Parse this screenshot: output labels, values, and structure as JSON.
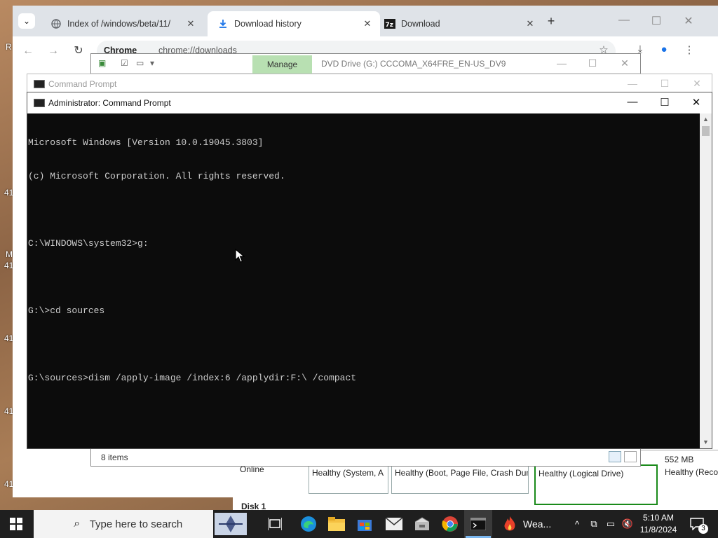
{
  "desktop": {
    "fragments": [
      "R",
      "41",
      "41",
      "41",
      "41",
      "41",
      "41",
      "M"
    ]
  },
  "chrome": {
    "tabs": [
      {
        "label": "Index of /windows/beta/11/",
        "icon": "globe-icon",
        "close": "✕"
      },
      {
        "label": "Download history",
        "icon": "download-icon",
        "close": "✕",
        "active": true
      },
      {
        "label": "Download",
        "icon": "7zip-icon",
        "close": "✕"
      }
    ],
    "new_tab": "+",
    "omnibox_chip": "Chrome",
    "url": "chrome://downloads",
    "controls": {
      "minimize": "—",
      "maximize": "☐",
      "close": "✕"
    }
  },
  "explorer": {
    "manage_label": "Manage",
    "caption": "DVD Drive (G:) CCCOMA_X64FRE_EN-US_DV9",
    "status_items": "8 items"
  },
  "disk_management": {
    "online": "Online",
    "cells": [
      "Healthy (System, A",
      "Healthy (Boot, Page File, Crash Dum",
      "Healthy (Logical Drive)",
      "Healthy (Reco"
    ],
    "size": "552 MB",
    "disk1": "Disk 1"
  },
  "cmd_back": {
    "title": "Command Prompt"
  },
  "cmd": {
    "title": "Administrator: Command Prompt",
    "lines": [
      "Microsoft Windows [Version 10.0.19045.3803]",
      "(c) Microsoft Corporation. All rights reserved.",
      "",
      "C:\\WINDOWS\\system32>g:",
      "",
      "G:\\>cd sources",
      "",
      "G:\\sources>dism /apply-image /index:6 /applydir:F:\\ /compact"
    ]
  },
  "taskbar": {
    "search_placeholder": "Type here to search",
    "weather": "Wea...",
    "time": "5:10 AM",
    "date": "11/8/2024",
    "notifications": "3"
  }
}
